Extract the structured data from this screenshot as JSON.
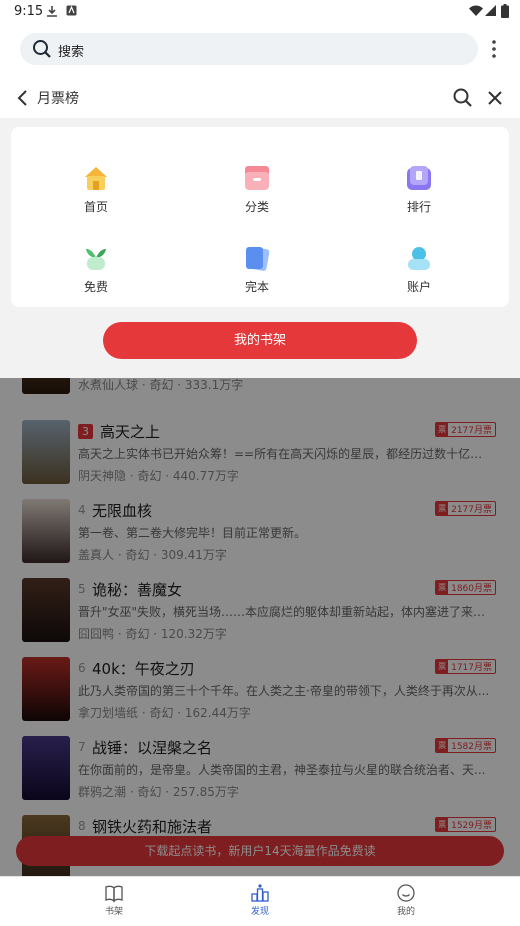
{
  "status_bar": {
    "time": "9:15"
  },
  "browser_bar": {
    "search_label": "搜索"
  },
  "page_header": {
    "title": "月票榜"
  },
  "menu": {
    "items": [
      {
        "label": "首页",
        "icon": "home-icon"
      },
      {
        "label": "分类",
        "icon": "category-icon"
      },
      {
        "label": "排行",
        "icon": "ranking-icon"
      },
      {
        "label": "免费",
        "icon": "free-icon"
      },
      {
        "label": "完本",
        "icon": "completed-icon"
      },
      {
        "label": "账户",
        "icon": "account-icon"
      }
    ],
    "shelf_button": "我的书架"
  },
  "books": [
    {
      "rank": "",
      "title": "",
      "desc": "",
      "meta": "水煮仙人球 · 奇幻 · 333.1万字",
      "votes": ""
    },
    {
      "rank": "3",
      "title": "高天之上",
      "desc": "高天之上实体书已开始众筹！==所有在高天闪烁的星辰，都经历过数十亿年...",
      "meta": "阴天神隐 · 奇幻 · 440.77万字",
      "votes": "2177月票"
    },
    {
      "rank": "4",
      "title": "无限血核",
      "desc": "第一卷、第二卷大修完毕！目前正常更新。",
      "meta": "盖真人 · 奇幻 · 309.41万字",
      "votes": "2177月票"
    },
    {
      "rank": "5",
      "title": "诡秘：善魔女",
      "desc": "晋升\"女巫\"失败，横死当场……本应腐烂的躯体却重新站起，体内塞进了来自...",
      "meta": "囧囧鸭 · 奇幻 · 120.32万字",
      "votes": "1860月票"
    },
    {
      "rank": "6",
      "title": "40k：午夜之刃",
      "desc": "此乃人类帝国的第三十个千年。在人类之主·帝皇的带领下，人类终于再次从...",
      "meta": "拿刀划墙纸 · 奇幻 · 162.44万字",
      "votes": "1717月票"
    },
    {
      "rank": "7",
      "title": "战锤：以涅槃之名",
      "desc": "在你面前的，是帝皇。人类帝国的主君，神圣泰拉与火星的联合统治者、天...",
      "meta": "群鸦之潮 · 奇幻 · 257.85万字",
      "votes": "1582月票"
    },
    {
      "rank": "8",
      "title": "钢铁火药和施法者",
      "desc": "",
      "meta": "",
      "votes": "1529月票"
    }
  ],
  "promo_bar": "下载起点读书，新用户14天海量作品免费读",
  "bottom_nav": [
    {
      "label": "书架",
      "icon": "book-icon"
    },
    {
      "label": "发现",
      "icon": "discover-icon"
    },
    {
      "label": "我的",
      "icon": "profile-icon"
    }
  ],
  "colors": {
    "accent_red": "#e5383b",
    "nav_active": "#2f5fd0"
  }
}
